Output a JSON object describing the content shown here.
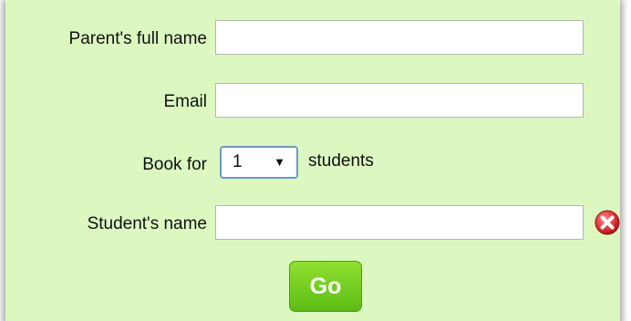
{
  "form": {
    "parent_name": {
      "label": "Parent's full name",
      "value": "",
      "placeholder": ""
    },
    "email": {
      "label": "Email",
      "value": "",
      "placeholder": ""
    },
    "book_for": {
      "label": "Book for",
      "selected": "1",
      "suffix": "students"
    },
    "student_name": {
      "label": "Student's name",
      "value": "",
      "placeholder": ""
    },
    "submit_label": "Go"
  },
  "icons": {
    "remove": "remove-student-icon"
  },
  "colors": {
    "panel_background": "#dcf8c0",
    "button_green": "#5cbc16",
    "remove_red": "#e23b3b",
    "select_border": "#6f98c9"
  }
}
